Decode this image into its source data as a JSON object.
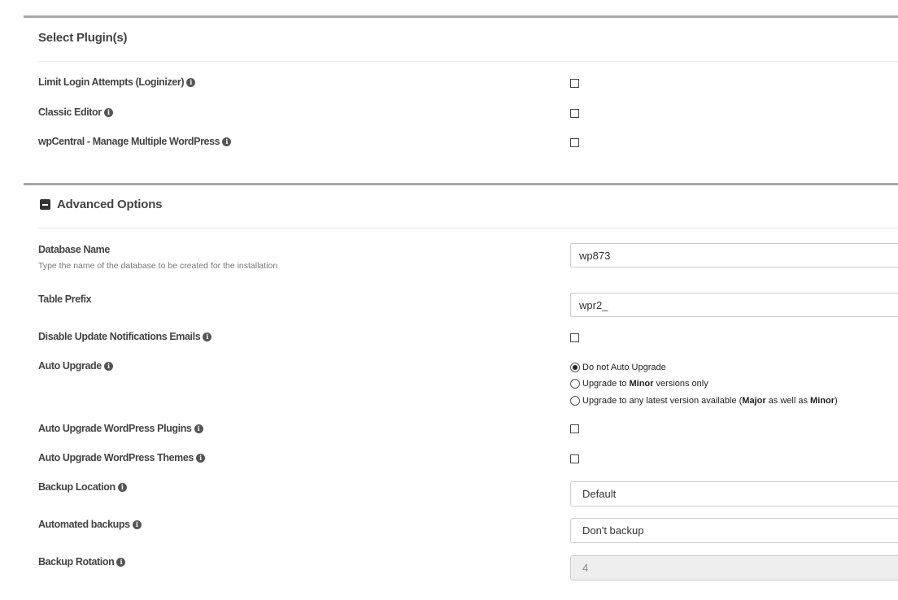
{
  "plugins": {
    "title": "Select Plugin(s)",
    "items": [
      {
        "label": "Limit Login Attempts (Loginizer)",
        "checked": false
      },
      {
        "label": "Classic Editor",
        "checked": false
      },
      {
        "label": "wpCentral - Manage Multiple WordPress",
        "checked": false
      }
    ]
  },
  "advanced": {
    "title": "Advanced Options",
    "database_name": {
      "label": "Database Name",
      "hint": "Type the name of the database to be created for the installation",
      "value": "wp873"
    },
    "table_prefix": {
      "label": "Table Prefix",
      "value": "wpr2_"
    },
    "disable_update_emails": {
      "label": "Disable Update Notifications Emails",
      "checked": false
    },
    "auto_upgrade": {
      "label": "Auto Upgrade",
      "options": {
        "opt1": {
          "text": "Do not Auto Upgrade",
          "selected": true
        },
        "opt2": {
          "pre": "Upgrade to ",
          "bold": "Minor",
          "post": " versions only",
          "selected": false
        },
        "opt3": {
          "pre": "Upgrade to any latest version available (",
          "bold1": "Major",
          "mid": " as well as ",
          "bold2": "Minor",
          "post": ")",
          "selected": false
        }
      }
    },
    "auto_upgrade_plugins": {
      "label": "Auto Upgrade WordPress Plugins",
      "checked": false
    },
    "auto_upgrade_themes": {
      "label": "Auto Upgrade WordPress Themes",
      "checked": false
    },
    "backup_location": {
      "label": "Backup Location",
      "value": "Default"
    },
    "automated_backups": {
      "label": "Automated backups",
      "value": "Don't backup"
    },
    "backup_rotation": {
      "label": "Backup Rotation",
      "value": "4",
      "disabled": true
    }
  },
  "icons": {
    "info": "info-circle-icon",
    "collapse": "minus-square-icon"
  }
}
